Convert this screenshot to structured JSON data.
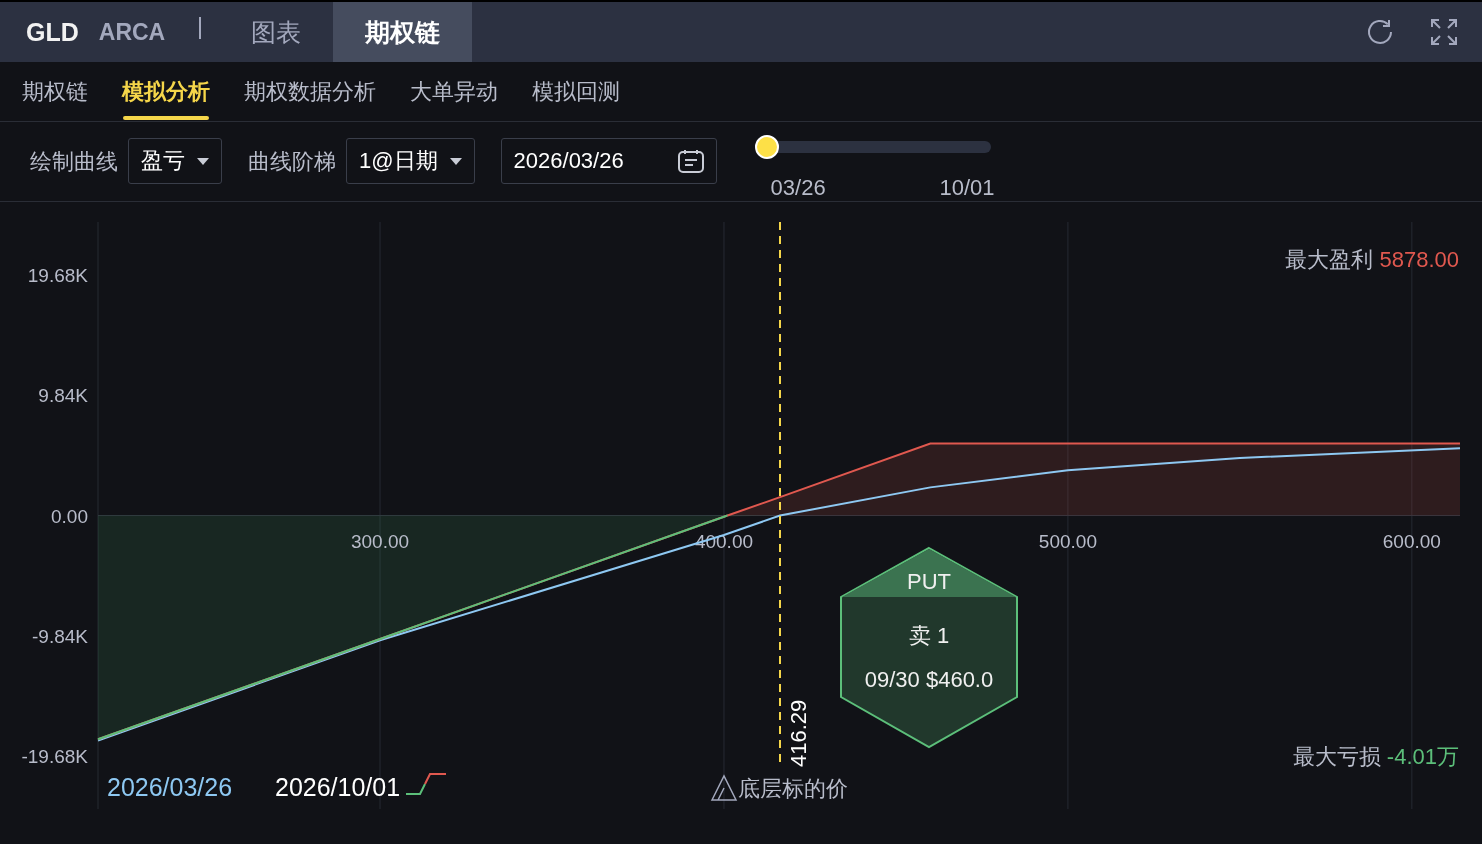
{
  "header": {
    "symbol": "GLD",
    "exchange": "ARCA",
    "tabs": [
      {
        "label": "图表",
        "selected": false
      },
      {
        "label": "期权链",
        "selected": true
      }
    ]
  },
  "subtabs": [
    {
      "label": "期权链",
      "selected": false
    },
    {
      "label": "模拟分析",
      "selected": true
    },
    {
      "label": "期权数据分析",
      "selected": false
    },
    {
      "label": "大单异动",
      "selected": false
    },
    {
      "label": "模拟回测",
      "selected": false
    }
  ],
  "toolbar": {
    "curve_label": "绘制曲线",
    "curve_value": "盈亏",
    "step_label": "曲线阶梯",
    "step_value": "1@日期",
    "date": "2026/03/26",
    "slider": {
      "level": 0,
      "start": "03/26",
      "end": "10/01"
    }
  },
  "chart": {
    "chart_data": {
      "type": "line",
      "x": [
        218,
        300,
        400,
        416.29,
        460,
        500,
        550,
        614
      ],
      "xlim": [
        218,
        614
      ],
      "ylim": [
        -24000,
        24000
      ],
      "grid": true,
      "ref_lines": [
        {
          "axis": "x",
          "value": 416.29,
          "color": "#f5d64a"
        }
      ],
      "xticks": [
        {
          "value": 300,
          "label": "300.00"
        },
        {
          "value": 400,
          "label": "400.00"
        },
        {
          "value": 500,
          "label": "500.00"
        },
        {
          "value": 600,
          "label": "600.00"
        }
      ],
      "yticks": [
        {
          "value": 19680,
          "label": "19.68K"
        },
        {
          "value": 9840,
          "label": "9.84K"
        },
        {
          "value": 0,
          "label": "0.00"
        },
        {
          "value": -9840,
          "label": "-9.84K"
        },
        {
          "value": -19680,
          "label": "-19.68K"
        }
      ],
      "series": [
        {
          "name": "2026/03/26",
          "color": "#8ec8f2",
          "values": [
            -18400,
            -10200,
            -1600,
            0,
            2300,
            3700,
            4700,
            5500
          ]
        },
        {
          "name": "2026/10/01",
          "color": "#e0584f",
          "values": [
            -18300,
            -10100,
            -100,
            1500,
            5878,
            5878,
            5878,
            5878
          ]
        }
      ]
    },
    "max_profit": {
      "label": "最大盈利",
      "value": "5878.00"
    },
    "max_loss": {
      "label": "最大亏损",
      "value": "-4.01万"
    },
    "underlying": {
      "label": "底层标的价",
      "price": "416.29"
    },
    "position": {
      "type": "PUT",
      "side": "卖 1",
      "contract": "09/30 $460.0"
    }
  }
}
